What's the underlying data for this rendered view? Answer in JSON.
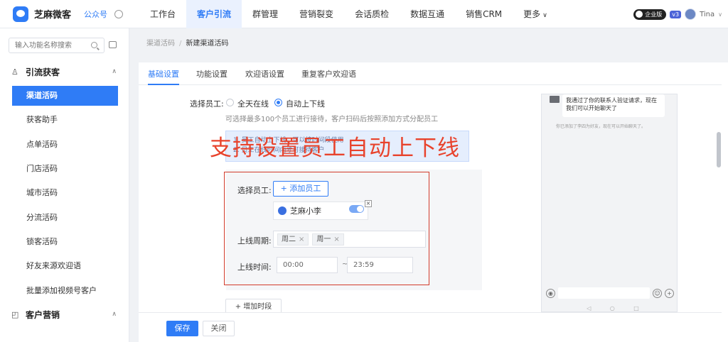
{
  "app": {
    "name": "芝麻微客",
    "gzh": "公众号"
  },
  "nav": {
    "items": [
      "工作台",
      "客户引流",
      "群管理",
      "营销裂变",
      "会话质检",
      "数据互通",
      "销售CRM",
      "更多"
    ],
    "active_index": 1,
    "enterprise_badge": "企业版",
    "version_badge": "v3",
    "user": "Tina"
  },
  "sidebar": {
    "search_placeholder": "输入功能名称搜索",
    "groups": [
      {
        "label": "引流获客",
        "items": [
          "渠道活码",
          "获客助手",
          "点单活码",
          "门店活码",
          "城市活码",
          "分流活码",
          "锁客活码",
          "好友来源欢迎语",
          "批量添加视频号客户"
        ],
        "active_item": 0
      },
      {
        "label": "客户营销"
      }
    ]
  },
  "breadcrumb": {
    "parent": "渠道活码",
    "current": "新建渠道活码"
  },
  "tabs": {
    "items": [
      "基础设置",
      "功能设置",
      "欢迎语设置",
      "重复客户欢迎语"
    ],
    "active_index": 0
  },
  "form": {
    "select_staff_label": "选择员工:",
    "radio_all_online": "全天在线",
    "radio_auto": "自动上下线",
    "selected_radio": "自动上下线",
    "hint": "可选择最多100个员工进行接待，客户扫码后按照添加方式分配员工",
    "notice_line1": "1. 员工自动上下线，可以按时间段使用",
    "notice_line2": "2. 员工在线时间内才可接待客户",
    "overlay_caption": "支持设置员工自动上下线",
    "inner": {
      "select_staff_label": "选择员工:",
      "add_staff_button": "+ 添加员工",
      "staff_name": "芝麻小李",
      "staff_online": true,
      "period_label": "上线周期:",
      "period_days": [
        "周二",
        "周一"
      ],
      "time_label": "上线时间:",
      "time_start": "00:00",
      "time_end": "23:59",
      "tilde": "~"
    },
    "add_slot_button": "+ 增加时段"
  },
  "footer": {
    "save": "保存",
    "close": "关闭"
  },
  "phone": {
    "bubble_text": "我通过了你的联系人验证请求，现在我们可以开始聊天了",
    "system_msg": "你已添加了李四为好友，现在可以开始聊天了。"
  },
  "colors": {
    "accent": "#2f7cf6",
    "overlay_red": "#e8432c",
    "box_red": "#d23c2c"
  }
}
